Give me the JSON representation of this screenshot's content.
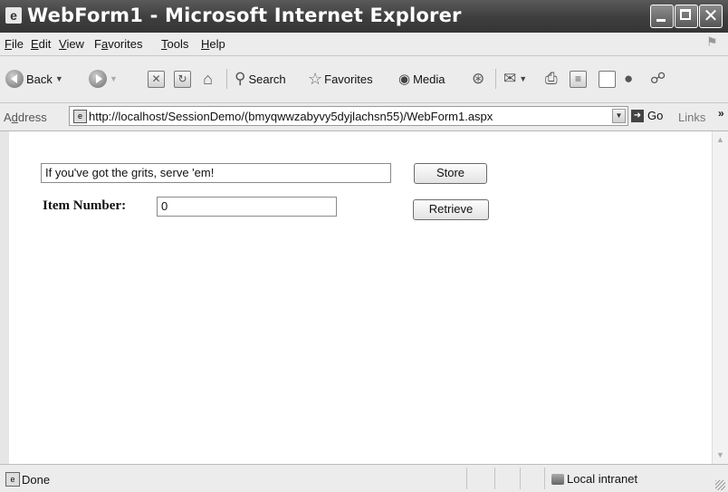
{
  "window": {
    "title": "WebForm1 - Microsoft Internet Explorer"
  },
  "menu": {
    "file": {
      "accel": "F",
      "rest": "ile"
    },
    "edit": {
      "accel": "E",
      "rest": "dit"
    },
    "view": {
      "accel": "V",
      "rest": "iew"
    },
    "favorites": {
      "pre": "F",
      "accel": "a",
      "rest": "vorites"
    },
    "tools": {
      "accel": "T",
      "rest": "ools"
    },
    "help": {
      "accel": "H",
      "rest": "elp"
    }
  },
  "toolbar": {
    "back": "Back",
    "search": "Search",
    "favorites": "Favorites",
    "media": "Media"
  },
  "address": {
    "label_pre": "A",
    "label_accel": "d",
    "label_rest": "dress",
    "url": "http://localhost/SessionDemo/(bmyqwwzabyvy5dyjlachsn55)/WebForm1.aspx",
    "go": "Go",
    "links": "Links"
  },
  "form": {
    "main_text": "If you've got the grits, serve 'em!",
    "item_label": "Item Number:",
    "item_value": "0",
    "store_button": "Store",
    "retrieve_button": "Retrieve"
  },
  "status": {
    "text": "Done",
    "zone": "Local intranet"
  }
}
